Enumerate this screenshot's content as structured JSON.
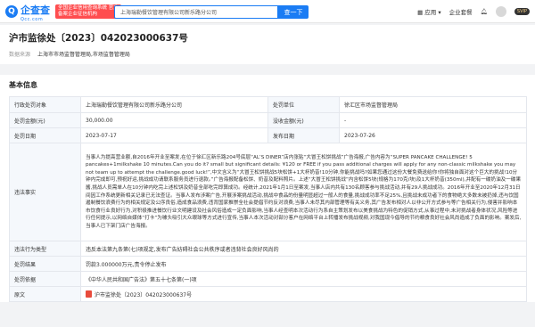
{
  "topbar": {
    "logo_main": "企查查",
    "logo_sub": "Qcc.com",
    "banner": "全国企业信用查询系统 官方备案企业征信机构",
    "search_value": "上海瑞勒餐饮管理有限公司新乐路分公司",
    "search_button": "查一下",
    "app_label": "应用",
    "enterprise_label": "企业套餐",
    "vip_label": "SVIP"
  },
  "header": {
    "title": "沪市监徐处〔2023〕042023000637号",
    "source_label": "数据来源",
    "source_value": "上海市市场监督管理局,市场监督管理局"
  },
  "basic": {
    "section_title": "基本信息",
    "rows": {
      "party_label": "行政处罚对象",
      "party_value": "上海瑞勒餐饮管理有限公司新乐路分公司",
      "office_label": "处罚单位",
      "office_value": "徐汇区市场监督管理局",
      "amount_label": "处罚金额(元)",
      "amount_value": "30,000.00",
      "confiscate_label": "没收金额(元)",
      "confiscate_value": "-",
      "date_label": "处罚日期",
      "date_value": "2023-07-17",
      "publish_label": "发布日期",
      "publish_value": "2023-07-26",
      "fact_label": "违法事实",
      "fact_value": "当事人为提高营业额,自2016年开业至案发,在位于徐汇区新乐路204号底层“AL’S DINER”店内张贴“大冒王松饼挑战”广告海报,广告内容为“SUPER PANCAKE CHALLENGE! 5 pancakes+1milkshake 10 minutes.Can you do it? small but significant details: ¥120 or FREE if you pass additional charges will apply for any non-classic milkshake you may not team up to attempt the challenge.good luck!”,中文含义为“大冒王松饼挑战5块松饼+1大杯奶昔!10分钟,你能挑战吗?如果您通过这份大餐免费送给你!你将独自面对这个巨大的挑战!10分钟内完成即可,预祝好运,挑战成功请联系服务员进行退款。”广告海报配备松饼、奶昔及配料照片。上述“大冒王松饼挑战”内含松饼5块(规格为170克/块)及1大杯奶昔(350ml),并配有一碟奶油及一碟果酱,挑战人员需单人在10分钟内吃完上述松饼及奶昔全部吃完即算成功。经统计,2021年1月1日至案发,当事人店内共有130名顾客参与挑战活动,并有29人挑战成功。2016年开业至2020年12月31日间因工作系统更新相关记录已无法查证。当事人发布涉案广告,开展涉案挑战活动,挑战中食品的份量明显超过一般人的食量,挑战成功率不足25%,且挑战未成功者下的食物绝大多数未被扔掉,违与饮国遏制餐饮浪费行为的相关规定及公序良俗,造成食品浪费,违背国家推崇全社会提倡节约反对浪费,当事人未尽其内部管理等有关义务,其广告发布相对人以非公开方式参与等广告相关行为,侵害并影响本市饮食行业良好行为,对积极推进餐饮行业文明建设及社会风俗造成一定负面影响,当事人经查明本次活动行为系自主策划发布以美食挑战为特色的促销方式,从事过程中,未对挑战者身体状况,风险等进行任何提示,以网络自媒体“打卡”为噱头吸引大众眼球等方式进行宣传,当事人本次活动对部分客户在网络平台上转播发布挑战视频,对我国现今倡导的节约粮食良好社会风尚造成了负面的影响。案发后,当事人已下架门店广告海报。",
      "type_label": "违法行为类型",
      "type_value": "违反本法第九条第(七)项规定,发布广告妨碍社会公共秩序或者违背社会良好风尚的",
      "result_label": "处罚结果",
      "result_value": "罚款3.000000万元,责令停止发布",
      "basis_label": "处罚依据",
      "basis_value": "《中华人民共和国广告法》第五十七条第(一)项",
      "doc_label": "原文",
      "doc_value": "沪市监徐处〔2023〕042023000637号"
    }
  }
}
